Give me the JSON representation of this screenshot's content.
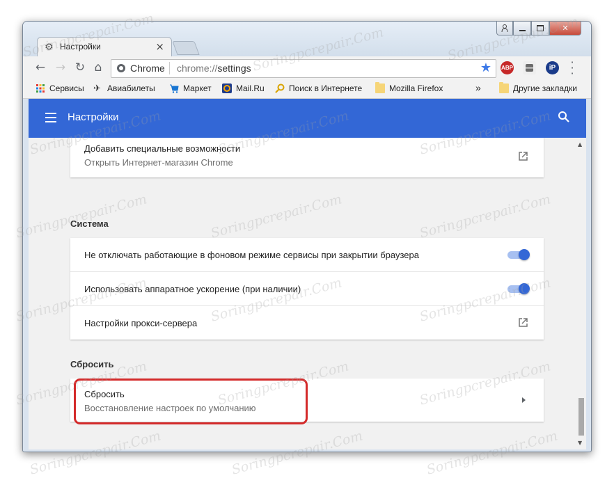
{
  "window": {
    "tab_title": "Настройки",
    "tab_icon": "gear-icon",
    "min_icon": "minimize-icon",
    "max_icon": "maximize-icon",
    "close_icon": "close-icon",
    "user_icon": "user-icon"
  },
  "toolbar": {
    "back": "←",
    "forward": "→",
    "reload": "↻",
    "home": "⌂",
    "omnibox_chip": "Chrome",
    "url_scheme": "chrome://",
    "url_path": "settings",
    "star": "★",
    "ext_abp": "ABP",
    "ext_ip": "iP"
  },
  "bookmarks": [
    {
      "label": "Сервисы",
      "icon": "apps-grid-icon"
    },
    {
      "label": "Авиабилеты",
      "icon": "airplane-icon"
    },
    {
      "label": "Маркет",
      "icon": "cart-icon"
    },
    {
      "label": "Mail.Ru",
      "icon": "mailru-icon"
    },
    {
      "label": "Поиск в Интернете",
      "icon": "search-key-icon"
    },
    {
      "label": "Mozilla Firefox",
      "icon": "folder-icon"
    }
  ],
  "bookmarks_more": "»",
  "bookmarks_other": "Другие закладки",
  "header": {
    "title": "Настройки"
  },
  "cards": {
    "accessibility": {
      "title": "Добавить специальные возможности",
      "subtitle": "Открыть Интернет-магазин Chrome"
    },
    "system": {
      "section": "Система",
      "rows": [
        {
          "label": "Не отключать работающие в фоновом режиме сервисы при закрытии браузера",
          "enabled": true
        },
        {
          "label": "Использовать аппаратное ускорение (при наличии)",
          "enabled": true
        },
        {
          "label": "Настройки прокси-сервера"
        }
      ]
    },
    "reset": {
      "section": "Сбросить",
      "title": "Сбросить",
      "subtitle": "Восстановление настроек по умолчанию"
    }
  },
  "colors": {
    "accent": "#3367d6",
    "highlight": "#d42a2a"
  },
  "watermark": "Soringpcrepair.Com"
}
